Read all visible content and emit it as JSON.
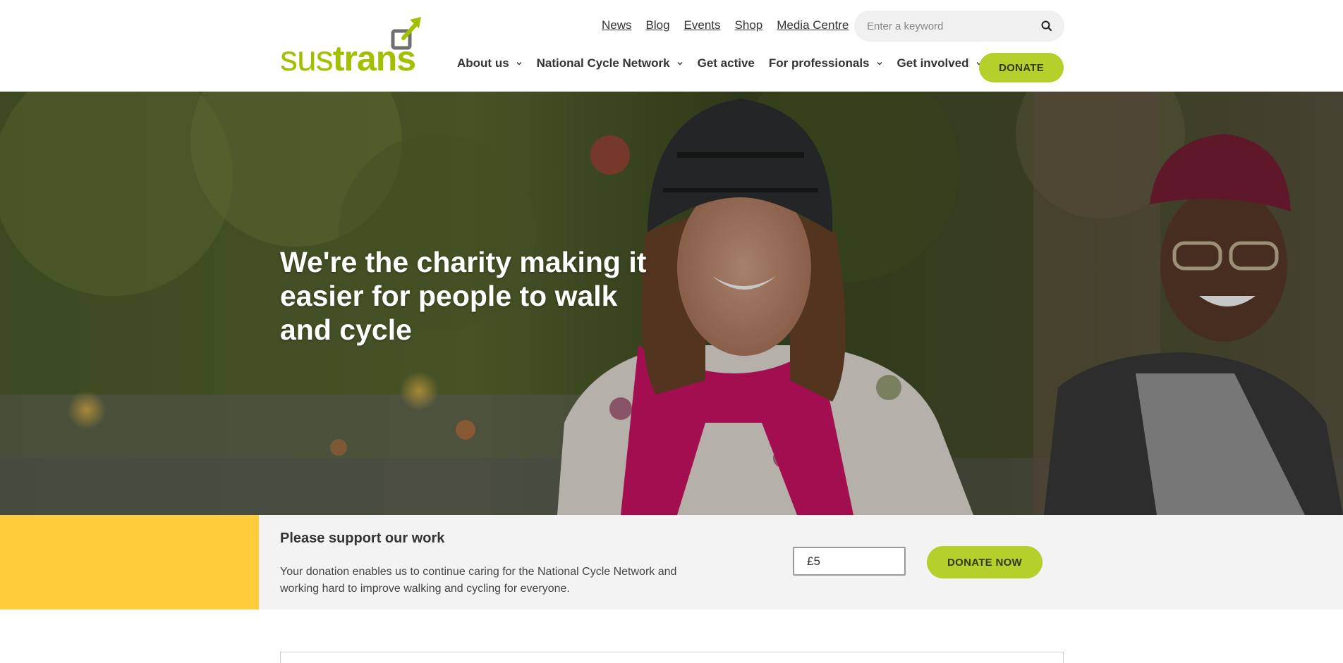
{
  "logo": {
    "part1": "sus",
    "part2": "trans",
    "brand_color": "#a4be00"
  },
  "top_links": [
    "News",
    "Blog",
    "Events",
    "Shop",
    "Media Centre"
  ],
  "search": {
    "placeholder": "Enter a keyword",
    "icon": "search-icon"
  },
  "main_nav": [
    {
      "label": "About us",
      "has_dropdown": true
    },
    {
      "label": "National Cycle Network",
      "has_dropdown": true
    },
    {
      "label": "Get active",
      "has_dropdown": false
    },
    {
      "label": "For professionals",
      "has_dropdown": true
    },
    {
      "label": "Get involved",
      "has_dropdown": true
    }
  ],
  "donate_label": "DONATE",
  "hero": {
    "title": "We're the charity making it easier for people to walk and cycle"
  },
  "support": {
    "title": "Please support our work",
    "text": "Your donation enables us to continue caring for the National Cycle Network and working hard to improve walking and cycling for everyone.",
    "amount_value": "£5",
    "donate_now_label": "DONATE NOW"
  },
  "colors": {
    "accent": "#b5cf2b",
    "yellow": "#ffcc3b",
    "strip_bg": "#f3f3f3"
  }
}
